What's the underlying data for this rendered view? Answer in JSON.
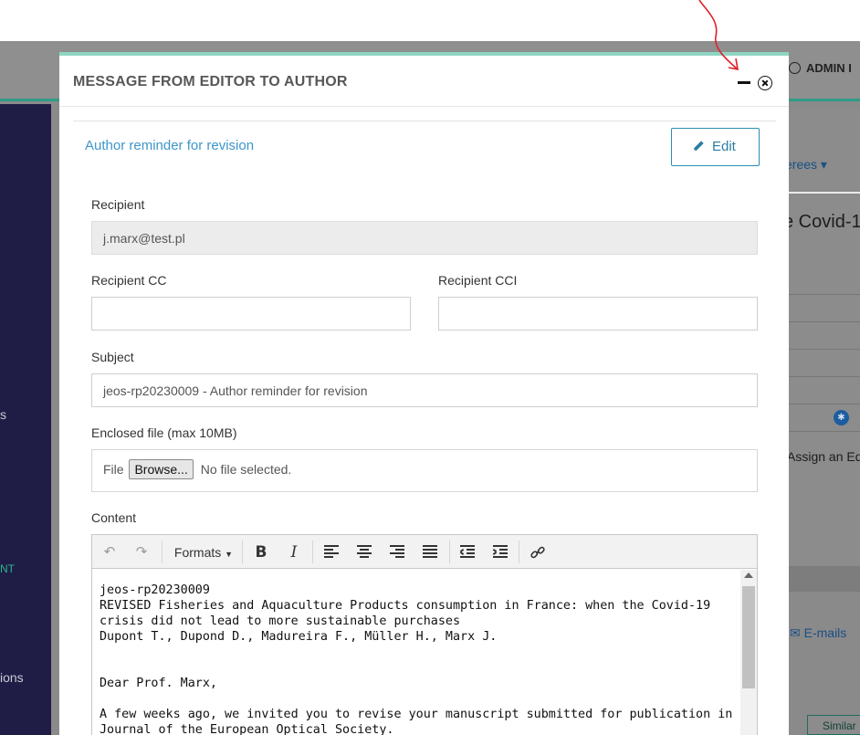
{
  "app": {
    "user_label": "ADMIN I",
    "sidebar_fragments": [
      "s",
      "NT",
      "ions"
    ],
    "right_fragments": {
      "referees": "erees ▾",
      "covid": "e Covid-1",
      "assign": "Assign an Ed",
      "emails": "E-mails",
      "similar": "Similar"
    }
  },
  "modal": {
    "title": "MESSAGE FROM EDITOR TO AUTHOR",
    "panel_heading": "Author reminder for revision",
    "edit_label": "Edit",
    "recipient": {
      "label": "Recipient",
      "value": "j.marx@test.pl"
    },
    "recipient_cc": {
      "label": "Recipient CC",
      "value": ""
    },
    "recipient_cci": {
      "label": "Recipient CCI",
      "value": ""
    },
    "subject": {
      "label": "Subject",
      "value": "jeos-rp20230009 - Author reminder for revision"
    },
    "enclosed_file": {
      "label": "Enclosed file (max 10MB)",
      "prefix": "File",
      "browse_label": "Browse...",
      "status": "No file selected."
    },
    "content": {
      "label": "Content",
      "formats_label": "Formats",
      "lines": [
        "jeos-rp20230009",
        "REVISED Fisheries and Aquaculture Products consumption in France: when the Covid-19 crisis did not lead to more sustainable purchases",
        "Dupont T., Dupond D., Madureira F., Müller H., Marx J.",
        "",
        "",
        "Dear Prof. Marx,",
        "",
        "A few weeks ago, we invited you to revise your manuscript submitted for publication in Journal of the European Optical Society."
      ]
    }
  },
  "colors": {
    "accent": "#3d96c9",
    "modal_top_border": "#8fd5c3",
    "sidebar": "#1f1d45",
    "annotation": "#e0202a"
  }
}
